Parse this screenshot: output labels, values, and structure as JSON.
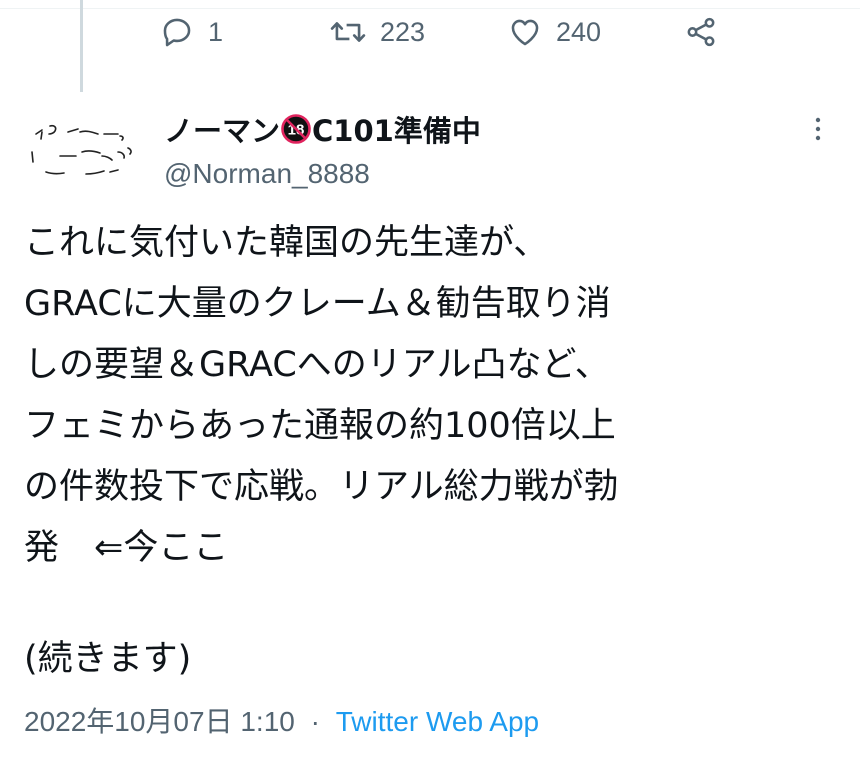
{
  "actions": {
    "reply": {
      "icon": "reply-icon",
      "count": "1"
    },
    "retweet": {
      "icon": "retweet-icon",
      "count": "223"
    },
    "like": {
      "icon": "heart-icon",
      "count": "240"
    },
    "share": {
      "icon": "share-icon"
    }
  },
  "tweet": {
    "author_name_prefix": "ノーマン",
    "author_badge": "18",
    "author_name_suffix": "C101準備中",
    "handle": "@Norman_8888",
    "body": "これに気付いた韓国の先生達が、\nGRACに大量のクレーム＆勧告取り消\nしの要望＆GRACへのリアル凸など、\nフェミからあった通報の約100倍以上\nの件数投下で応戦。リアル総力戦が勃\n発　⇐今ここ",
    "continued": "(続きます)",
    "timestamp": "2022年10月07日 1:10",
    "separator": "·",
    "source": "Twitter Web App"
  },
  "colors": {
    "text_primary": "#0f1419",
    "text_secondary": "#536471",
    "link": "#1d9bf0",
    "badge_red": "#e0245e"
  }
}
